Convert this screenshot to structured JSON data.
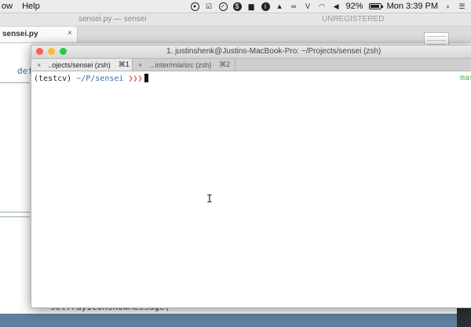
{
  "menubar": {
    "menus": [
      "ow",
      "Help"
    ],
    "battery_percent": "92%",
    "battery_level": 0.92,
    "clock": "Mon 3:39 PM"
  },
  "sublime": {
    "title": "sensei.py — sensei",
    "unregistered": "UNREGISTERED",
    "tab_label": "sensei.py",
    "tab_close": "×",
    "ghost_close": "×",
    "code_def": "def",
    "code_bottom": "setTrayIconShowMessage("
  },
  "terminal": {
    "title": "1. justinshenk@Justins-MacBook-Pro: ~/Projects/sensei (zsh)",
    "tabs": [
      {
        "label": "..ojects/sensei (zsh)",
        "shortcut": "⌘1",
        "close": "×"
      },
      {
        "label": "...inter/mia/src (zsh)",
        "shortcut": "⌘2",
        "close": "×"
      }
    ],
    "prompt_env": "(testcv)",
    "prompt_path": "~/P/sensei",
    "prompt_arrows": "❯❯❯",
    "right_prompt": "mas",
    "ibeam": "I"
  },
  "colors": {
    "close": "#fc5f57",
    "minimize": "#fdbc2e",
    "zoom": "#28c840",
    "path_blue": "#3a6ea5"
  }
}
